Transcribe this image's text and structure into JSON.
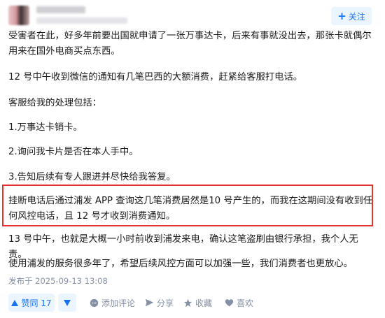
{
  "header": {
    "follow_label": "关注",
    "follow_icon": "plus-icon"
  },
  "paragraphs": [
    "受害者在此，好多年前要出国就申请了一张万事达卡，后来有事就没出去，那张卡就偶尔用来在国外电商买点东西。",
    "12 号中午收到微信的通知有几笔巴西的大额消费，赶紧给客服打电话。",
    "客服给我的处理包括：",
    "1.万事达卡销卡。",
    "2.询问我卡片是否在本人手中。",
    "3.告知后续有专人跟进并尽快给我答复。",
    "挂断电话后通过浦发 APP 查询这几笔消费居然是10 号产生的，而我在这期间没有收到任何风控电话，且 12 号才收到消费通知。",
    "13 号中午，也就是大概一小时前收到浦发来电，确认这笔盗刷由银行承担，我个人无责。",
    "使用浦发的服务很多年了，希望后续风控方面可以加强一些，我们消费者也更放心。"
  ],
  "meta": {
    "published": "发布于 2025-09-13 13:08"
  },
  "actions": {
    "vote_label": "赞同 17",
    "comment_label": "添加评论",
    "share_label": "分享",
    "favorite_label": "收藏",
    "like_label": "喜欢"
  },
  "colors": {
    "accent": "#1772f6",
    "highlight_border": "#e8322e",
    "muted": "#8590a6"
  }
}
